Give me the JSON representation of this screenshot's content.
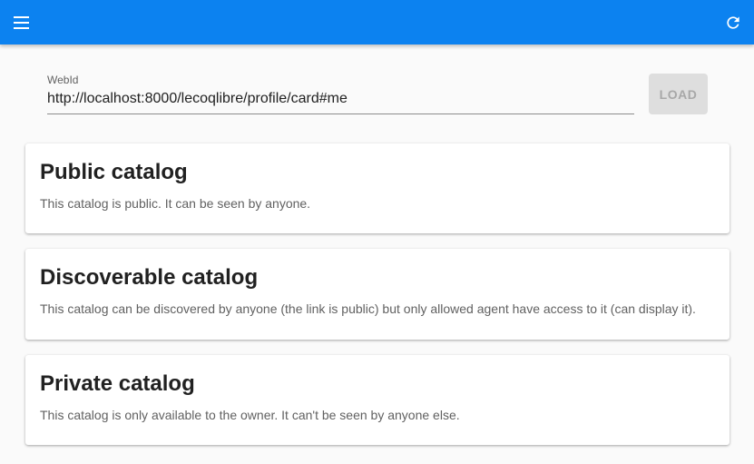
{
  "colors": {
    "primary": "#0c82f0",
    "background": "#fafafa",
    "card": "#ffffff"
  },
  "appbar": {
    "menu_icon": "menu-icon",
    "refresh_icon": "refresh-icon"
  },
  "webid": {
    "label": "WebId",
    "value": "http://localhost:8000/lecoqlibre/profile/card#me"
  },
  "load_button": {
    "label": "LOAD"
  },
  "catalogs": [
    {
      "title": "Public catalog",
      "description": "This catalog is public. It can be seen by anyone."
    },
    {
      "title": "Discoverable catalog",
      "description": "This catalog can be discovered by anyone (the link is public) but only allowed agent have access to it (can display it)."
    },
    {
      "title": "Private catalog",
      "description": "This catalog is only available to the owner. It can't be seen by anyone else."
    }
  ]
}
